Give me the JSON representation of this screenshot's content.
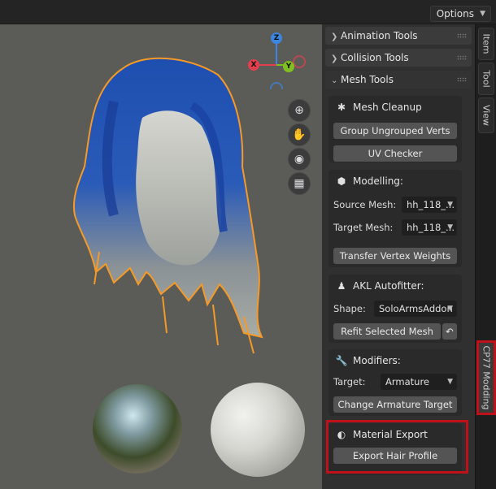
{
  "header": {
    "options_label": "Options"
  },
  "tabs": {
    "item": "Item",
    "tool": "Tool",
    "view": "View",
    "cp77": "CP77 Modding"
  },
  "gizmo": {
    "x": "X",
    "y": "Y",
    "z": "Z"
  },
  "panels": {
    "animation": "Animation Tools",
    "collision": "Collision Tools",
    "mesh_tools": "Mesh Tools"
  },
  "mesh_cleanup": {
    "title": "Mesh Cleanup",
    "group_btn": "Group Ungrouped Verts",
    "uv_btn": "UV Checker"
  },
  "modelling": {
    "title": "Modelling:",
    "source_label": "Source Mesh:",
    "source_value": "hh_118_...",
    "target_label": "Target Mesh:",
    "target_value": "hh_118_...",
    "transfer_btn": "Transfer Vertex Weights"
  },
  "autofitter": {
    "title": "AKL Autofitter:",
    "shape_label": "Shape:",
    "shape_value": "SoloArmsAddon",
    "refit_btn": "Refit Selected Mesh"
  },
  "modifiers": {
    "title": "Modifiers:",
    "target_label": "Target:",
    "target_value": "Armature",
    "change_btn": "Change Armature Target"
  },
  "material_export": {
    "title": "Material Export",
    "export_btn": "Export Hair Profile"
  },
  "colors": {
    "highlight": "#c0101a",
    "viewport_bg": "#5b5b57",
    "axis_x": "#e2404f",
    "axis_y": "#7fbf1f",
    "axis_z": "#3b86e0",
    "selection_outline": "#f59a26"
  }
}
